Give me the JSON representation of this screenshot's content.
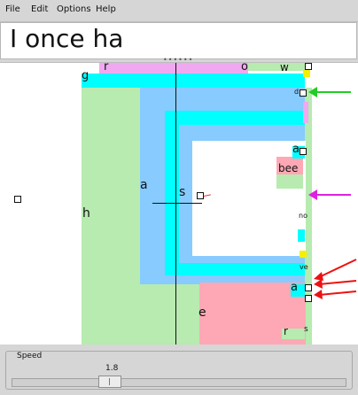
{
  "menu": {
    "file": "File",
    "edit": "Edit",
    "options": "Options",
    "help": "Help"
  },
  "text_entry": {
    "value": "I once ha"
  },
  "grip": "••••••",
  "canvas": {
    "labels": {
      "g": "g",
      "r_top": "r",
      "o_top": "o",
      "w_top": "w",
      "h": "h",
      "a_left": "a",
      "s_mid": "s",
      "a_right": "a",
      "bee": "bee",
      "e_bottom": "e",
      "a_bottom": "a",
      "r_bottom": "r",
      "s_bottom": "s",
      "d_small": "d",
      "no_small": "no",
      "ve_small": "ve"
    },
    "colors": {
      "cyan": "#00ffff",
      "green": "#b7ebb0",
      "blue": "#87cbff",
      "pink": "#ffa8b5",
      "magenta": "#f0a8f0",
      "yellow": "#f4f000",
      "arrow_green": "#22cc22",
      "arrow_magenta": "#e020e0",
      "arrow_red": "#ee1111"
    }
  },
  "speed": {
    "title": "Speed",
    "value": "1.8",
    "level": 0.3
  }
}
